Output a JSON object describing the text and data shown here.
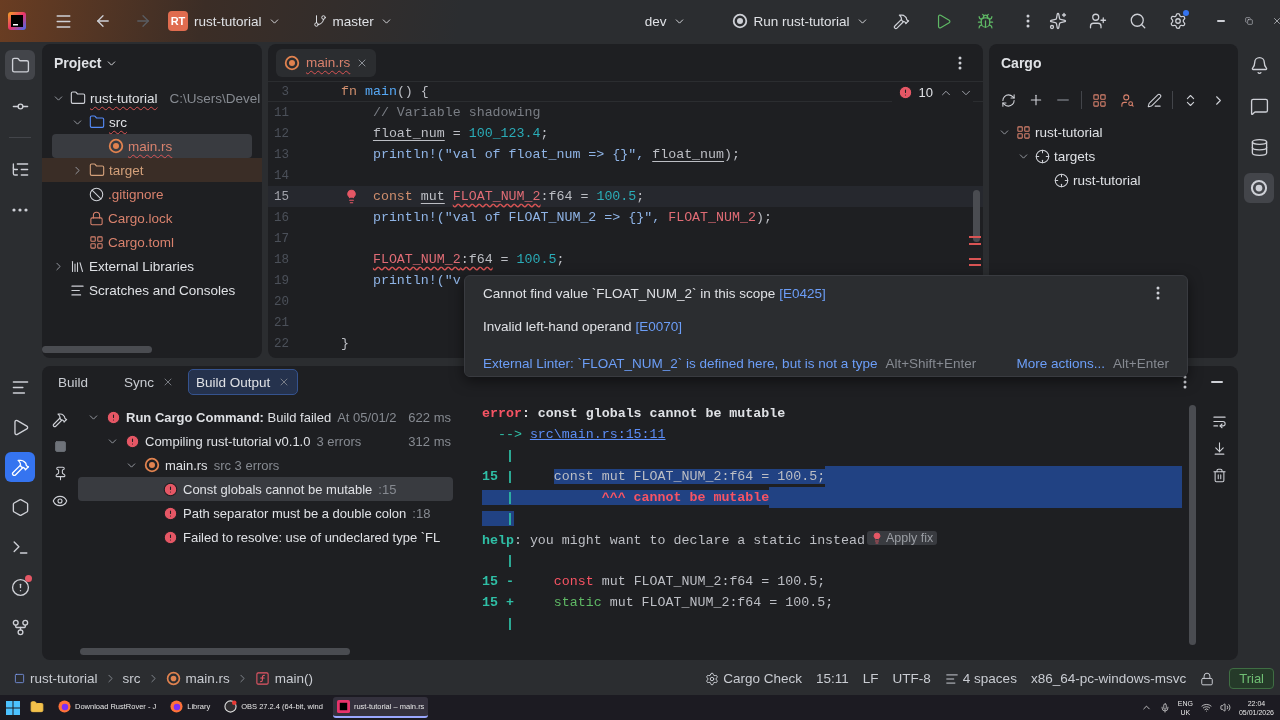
{
  "title_bar": {
    "project_badge": "RT",
    "project": "rust-tutorial",
    "branch": "master",
    "profile": "dev",
    "run_config": "Run rust-tutorial",
    "settings_dot": true
  },
  "left_toolbar": {
    "top": [
      {
        "kind": "project",
        "selected": true
      },
      {
        "kind": "commit",
        "selected": false
      },
      {
        "kind": "structure",
        "selected": false
      },
      {
        "kind": "more",
        "selected": false
      }
    ],
    "bottom": [
      {
        "kind": "log",
        "selected": false
      },
      {
        "kind": "run",
        "selected": false
      },
      {
        "kind": "build",
        "selected": true
      },
      {
        "kind": "services",
        "selected": false
      },
      {
        "kind": "terminal",
        "selected": false
      },
      {
        "kind": "problems",
        "selected": false,
        "alert": true
      },
      {
        "kind": "git",
        "selected": false
      }
    ]
  },
  "right_toolbar": [
    {
      "kind": "notifications",
      "selected": false
    },
    {
      "kind": "ai_chat",
      "selected": false
    },
    {
      "kind": "database",
      "selected": false
    },
    {
      "kind": "rust",
      "selected": true
    }
  ],
  "project": {
    "title": "Project",
    "tree": [
      {
        "label": "rust-tutorial",
        "kind": "folder",
        "path": "C:\\Users\\Devel",
        "expanded": true,
        "selected": false,
        "has_errors": true,
        "children": [
          {
            "label": "src",
            "kind": "source_folder",
            "expanded": true,
            "selected": false,
            "has_errors": true,
            "children": [
              {
                "label": "main.rs",
                "kind": "rust_file",
                "selected": true,
                "has_errors": true,
                "color": "#d9826d"
              }
            ]
          },
          {
            "label": "target",
            "kind": "excluded_folder",
            "expanded": false,
            "selected": false,
            "color": "#d3a07a"
          },
          {
            "label": ".gitignore",
            "kind": "ignore_file",
            "selected": false,
            "color": "#d9826d"
          },
          {
            "label": "Cargo.lock",
            "kind": "lock_file",
            "selected": false,
            "color": "#d9826d"
          },
          {
            "label": "Cargo.toml",
            "kind": "toml_file",
            "selected": false,
            "color": "#d9826d"
          }
        ]
      },
      {
        "label": "External Libraries",
        "kind": "libraries",
        "expanded": false,
        "selected": false
      },
      {
        "label": "Scratches and Consoles",
        "kind": "scratches",
        "selected": false
      }
    ]
  },
  "editor": {
    "tabs": [
      {
        "label": "main.rs",
        "selected": true,
        "has_errors": true
      }
    ],
    "error_count": "10",
    "sticky": {
      "number": "3",
      "tokens": [
        {
          "text": "fn",
          "kind": "kw"
        },
        {
          "text": " main",
          "kind": "fn"
        },
        {
          "text": "() {",
          "kind": "plain"
        }
      ]
    },
    "lines": [
      {
        "number": "11",
        "current": false,
        "tokens": [
          {
            "text": "    // Variable shadowing",
            "kind": "comment"
          }
        ]
      },
      {
        "number": "12",
        "current": false,
        "tokens": [
          {
            "text": "    float_num",
            "kind": "var"
          },
          {
            "text": " = ",
            "kind": "plain"
          },
          {
            "text": "100_123.4",
            "kind": "num"
          },
          {
            "text": ";",
            "kind": "plain"
          }
        ]
      },
      {
        "number": "13",
        "current": false,
        "tokens": [
          {
            "text": "    println!(\"val of float_num => {}\", ",
            "kind": "macro"
          },
          {
            "text": "float_num",
            "kind": "var"
          },
          {
            "text": ");",
            "kind": "plain"
          }
        ]
      },
      {
        "number": "14",
        "current": false
      },
      {
        "number": "15",
        "current": true,
        "bulb": true,
        "tokens": [
          {
            "text": "    const",
            "kind": "kw"
          },
          {
            "text": " mut",
            "kind": "var"
          },
          {
            "text": " FLOAT_NUM_2",
            "kind": "error"
          },
          {
            "text": ":f64 = ",
            "kind": "plain"
          },
          {
            "text": "100.5",
            "kind": "num"
          },
          {
            "text": ";",
            "kind": "plain"
          }
        ]
      },
      {
        "number": "16",
        "current": false,
        "tokens": [
          {
            "text": "    println!(\"val of FLOAT_NUM_2 => {}\", ",
            "kind": "macro"
          },
          {
            "text": "FLOAT_NUM_2",
            "kind": "const_ref"
          },
          {
            "text": ");",
            "kind": "plain"
          }
        ]
      },
      {
        "number": "17",
        "current": false
      },
      {
        "number": "18",
        "current": false,
        "tokens": [
          {
            "text": "    FLOAT_NUM_2",
            "kind": "error"
          },
          {
            "text": ":f64",
            "kind": "error_plain"
          },
          {
            "text": " = ",
            "kind": "plain"
          },
          {
            "text": "100.5",
            "kind": "num"
          },
          {
            "text": ";",
            "kind": "plain"
          }
        ]
      },
      {
        "number": "19",
        "current": false,
        "tokens": [
          {
            "text": "    println!(\"v",
            "kind": "macro"
          }
        ]
      },
      {
        "number": "20",
        "current": false
      },
      {
        "number": "21",
        "current": false
      },
      {
        "number": "22",
        "current": false,
        "tokens": [
          {
            "text": "}",
            "kind": "plain"
          }
        ]
      }
    ]
  },
  "popup": {
    "messages": [
      {
        "text": "Cannot find value `FLOAT_NUM_2` in this scope",
        "code": "[E0425]"
      },
      {
        "text": "Invalid left-hand operand",
        "code": "[E0070]"
      }
    ],
    "action": {
      "text": "External Linter: `FLOAT_NUM_2` is defined here, but is not a type",
      "shortcut": "Alt+Shift+Enter"
    },
    "more": {
      "text": "More actions...",
      "shortcut": "Alt+Enter"
    }
  },
  "cargo": {
    "title": "Cargo",
    "tree": [
      {
        "label": "rust-tutorial",
        "kind": "project",
        "expanded": true,
        "children": [
          {
            "label": "targets",
            "kind": "targets",
            "expanded": true,
            "children": [
              {
                "label": "rust-tutorial",
                "kind": "target"
              }
            ]
          }
        ]
      }
    ]
  },
  "build": {
    "tabs": [
      {
        "label": "Build",
        "selected": false,
        "closable": false
      },
      {
        "label": "Sync",
        "selected": false,
        "closable": true
      },
      {
        "label": "Build Output",
        "selected": true,
        "closable": true
      }
    ],
    "tree": [
      {
        "kind": "task",
        "title": "Run Cargo Command:",
        "message": "Build failed",
        "meta": "At 05/01/2",
        "time": "622 ms",
        "expanded": true,
        "selected": false,
        "children": [
          {
            "kind": "task",
            "title": "Compiling rust-tutorial v0.1.0",
            "meta": "3 errors",
            "time": "312 ms",
            "expanded": true,
            "selected": false,
            "children": [
              {
                "kind": "file",
                "title": "main.rs",
                "meta": "src 3 errors",
                "expanded": true,
                "selected": false,
                "children": [
                  {
                    "kind": "error",
                    "title": "Const globals cannot be mutable",
                    "meta": ":15",
                    "selected": true
                  },
                  {
                    "kind": "error",
                    "title": "Path separator must be a double colon",
                    "meta": ":18",
                    "selected": false
                  },
                  {
                    "kind": "error",
                    "title": "Failed to resolve: use of undeclared type `FL",
                    "selected": false
                  }
                ]
              }
            ]
          }
        ]
      }
    ],
    "output": [
      {
        "segments": [
          {
            "text": "error",
            "kind": "error_label"
          },
          {
            "text": ": const globals cannot be mutable",
            "kind": "bold"
          }
        ]
      },
      {
        "segments": [
          {
            "text": "  --> ",
            "kind": "arrow"
          },
          {
            "text": "src\\main.rs:15:11",
            "kind": "link"
          }
        ]
      },
      {
        "segments": [
          {
            "text": "   |",
            "kind": "gutter"
          }
        ]
      },
      {
        "selected_to_end": true,
        "segments": [
          {
            "text": "15 |     ",
            "kind": "gutter"
          },
          {
            "text": "const mut FLOAT_NUM_2:f64 = 100.5;",
            "kind": "code",
            "selected": true
          }
        ]
      },
      {
        "selected_to_end": true,
        "segments": [
          {
            "text": "   |           ",
            "kind": "gutter",
            "selected": true
          },
          {
            "text": "^^^ cannot be mutable",
            "kind": "note",
            "selected": true
          }
        ]
      },
      {
        "segments": [
          {
            "text": "   |",
            "kind": "gutter",
            "selected": true
          }
        ]
      },
      {
        "segments": [
          {
            "text": "help",
            "kind": "help_label"
          },
          {
            "text": ": you might want to declare a static instead",
            "kind": "text"
          },
          {
            "text": "Apply fix",
            "kind": "fix"
          }
        ]
      },
      {
        "segments": [
          {
            "text": "   |",
            "kind": "gutter"
          }
        ]
      },
      {
        "segments": [
          {
            "text": "15 -     ",
            "kind": "gutter"
          },
          {
            "text": "const",
            "kind": "removed"
          },
          {
            "text": " mut FLOAT_NUM_2:f64 = 100.5;",
            "kind": "code"
          }
        ]
      },
      {
        "segments": [
          {
            "text": "15 +     ",
            "kind": "gutter"
          },
          {
            "text": "static",
            "kind": "added"
          },
          {
            "text": " mut FLOAT_NUM_2:f64 = 100.5;",
            "kind": "code"
          }
        ]
      },
      {
        "segments": [
          {
            "text": "   |",
            "kind": "gutter"
          }
        ]
      }
    ]
  },
  "status_bar": {
    "breadcrumbs": [
      {
        "kind": "project",
        "label": "rust-tutorial"
      },
      {
        "kind": "folder",
        "label": "src"
      },
      {
        "kind": "rust_file",
        "label": "main.rs"
      },
      {
        "kind": "function",
        "label": "main()"
      }
    ],
    "widgets": [
      {
        "kind": "cargo",
        "label": "Cargo Check"
      },
      {
        "kind": "text",
        "label": "15:11"
      },
      {
        "kind": "text",
        "label": "LF"
      },
      {
        "kind": "text",
        "label": "UTF-8"
      },
      {
        "kind": "indent",
        "label": "4 spaces"
      },
      {
        "kind": "text",
        "label": "x86_64-pc-windows-msvc"
      },
      {
        "kind": "lock"
      }
    ],
    "license": "Trial"
  },
  "taskbar": {
    "apps": [
      {
        "kind": "explorer",
        "active": false
      },
      {
        "kind": "browser",
        "label": "Download RustRover - J",
        "active": false
      },
      {
        "kind": "browser",
        "label": "Library",
        "active": false
      },
      {
        "kind": "obs",
        "label": "OBS 27.2.4 (64-bit, wind",
        "active": false
      },
      {
        "kind": "ide",
        "label": "rust-tutorial – main.rs",
        "active": true
      }
    ],
    "tray": {
      "language": "ENG",
      "region": "UK",
      "time": "22:04",
      "date": "05/01/2026"
    }
  }
}
